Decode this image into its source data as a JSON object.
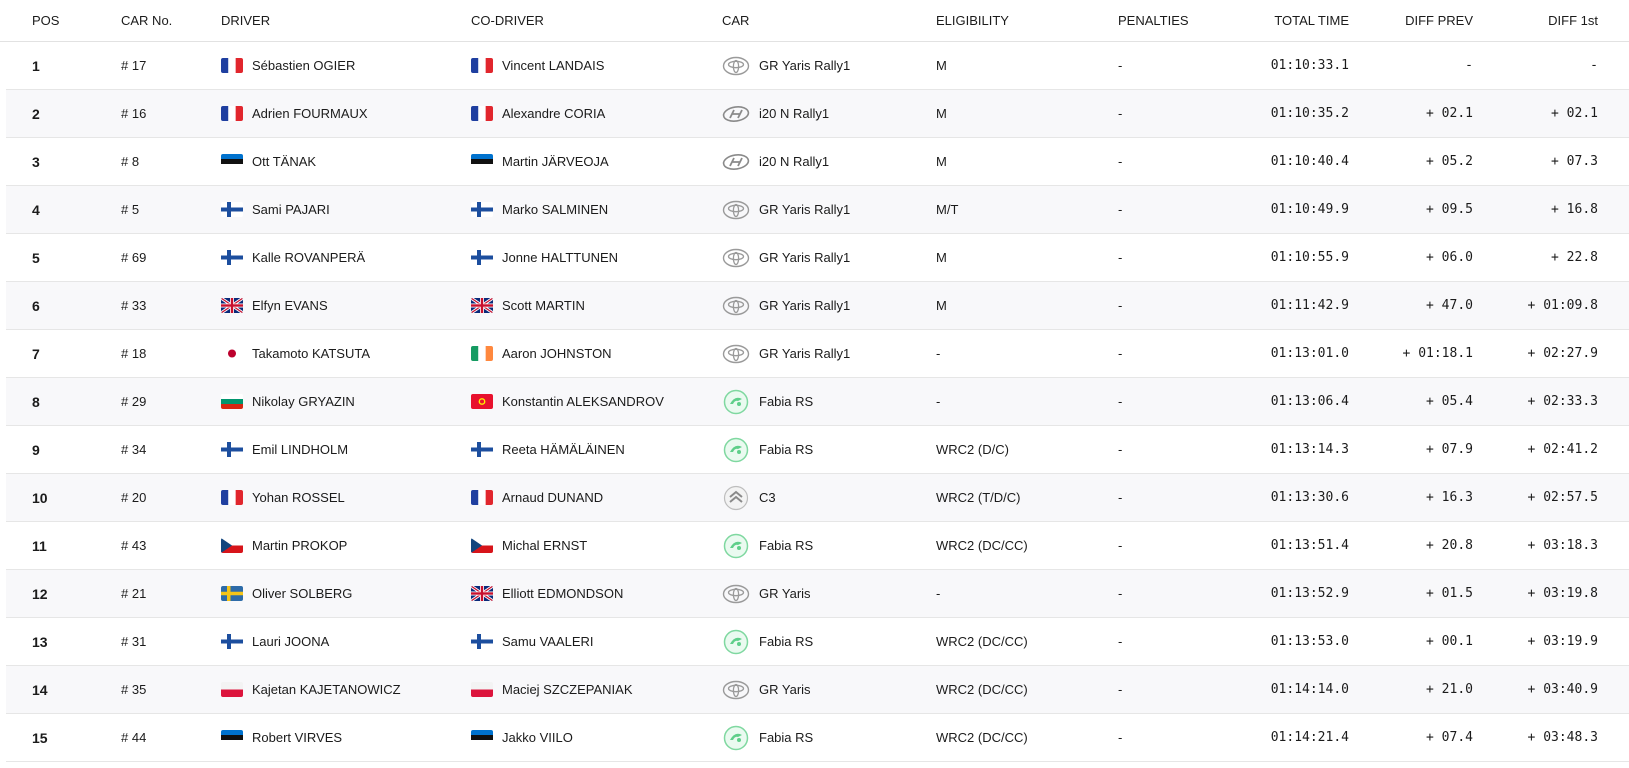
{
  "headers": {
    "pos": "POS",
    "car_no": "CAR No.",
    "driver": "DRIVER",
    "co_driver": "CO-DRIVER",
    "car": "CAR",
    "eligibility": "ELIGIBILITY",
    "penalties": "PENALTIES",
    "total_time": "TOTAL TIME",
    "diff_prev": "DIFF PREV",
    "diff_1st": "DIFF 1st"
  },
  "rows": [
    {
      "pos": "1",
      "car_no": "# 17",
      "driver": "Sébastien OGIER",
      "driver_flag": "fr",
      "co_driver": "Vincent LANDAIS",
      "co_driver_flag": "fr",
      "car": "GR Yaris Rally1",
      "car_logo": "toyota-logo",
      "eligibility": "M",
      "penalties": "-",
      "total_time": "01:10:33.1",
      "diff_prev": "-",
      "diff_1st": "-"
    },
    {
      "pos": "2",
      "car_no": "# 16",
      "driver": "Adrien FOURMAUX",
      "driver_flag": "fr",
      "co_driver": "Alexandre CORIA",
      "co_driver_flag": "fr",
      "car": "i20 N Rally1",
      "car_logo": "hyundai-logo",
      "eligibility": "M",
      "penalties": "-",
      "total_time": "01:10:35.2",
      "diff_prev": "+ 02.1",
      "diff_1st": "+ 02.1"
    },
    {
      "pos": "3",
      "car_no": "# 8",
      "driver": "Ott TÄNAK",
      "driver_flag": "ee",
      "co_driver": "Martin JÄRVEOJA",
      "co_driver_flag": "ee",
      "car": "i20 N Rally1",
      "car_logo": "hyundai-logo",
      "eligibility": "M",
      "penalties": "-",
      "total_time": "01:10:40.4",
      "diff_prev": "+ 05.2",
      "diff_1st": "+ 07.3"
    },
    {
      "pos": "4",
      "car_no": "# 5",
      "driver": "Sami PAJARI",
      "driver_flag": "fi",
      "co_driver": "Marko SALMINEN",
      "co_driver_flag": "fi",
      "car": "GR Yaris Rally1",
      "car_logo": "toyota-logo",
      "eligibility": "M/T",
      "penalties": "-",
      "total_time": "01:10:49.9",
      "diff_prev": "+ 09.5",
      "diff_1st": "+ 16.8"
    },
    {
      "pos": "5",
      "car_no": "# 69",
      "driver": "Kalle ROVANPERÄ",
      "driver_flag": "fi",
      "co_driver": "Jonne HALTTUNEN",
      "co_driver_flag": "fi",
      "car": "GR Yaris Rally1",
      "car_logo": "toyota-logo",
      "eligibility": "M",
      "penalties": "-",
      "total_time": "01:10:55.9",
      "diff_prev": "+ 06.0",
      "diff_1st": "+ 22.8"
    },
    {
      "pos": "6",
      "car_no": "# 33",
      "driver": "Elfyn EVANS",
      "driver_flag": "gb",
      "co_driver": "Scott MARTIN",
      "co_driver_flag": "gb",
      "car": "GR Yaris Rally1",
      "car_logo": "toyota-logo",
      "eligibility": "M",
      "penalties": "-",
      "total_time": "01:11:42.9",
      "diff_prev": "+ 47.0",
      "diff_1st": "+ 01:09.8"
    },
    {
      "pos": "7",
      "car_no": "# 18",
      "driver": "Takamoto KATSUTA",
      "driver_flag": "jp",
      "co_driver": "Aaron JOHNSTON",
      "co_driver_flag": "ie",
      "car": "GR Yaris Rally1",
      "car_logo": "toyota-logo",
      "eligibility": "-",
      "penalties": "-",
      "total_time": "01:13:01.0",
      "diff_prev": "+ 01:18.1",
      "diff_1st": "+ 02:27.9"
    },
    {
      "pos": "8",
      "car_no": "# 29",
      "driver": "Nikolay GRYAZIN",
      "driver_flag": "bg",
      "co_driver": "Konstantin ALEKSANDROV",
      "co_driver_flag": "kg",
      "car": "Fabia RS",
      "car_logo": "skoda-logo",
      "eligibility": "-",
      "penalties": "-",
      "total_time": "01:13:06.4",
      "diff_prev": "+ 05.4",
      "diff_1st": "+ 02:33.3"
    },
    {
      "pos": "9",
      "car_no": "# 34",
      "driver": "Emil LINDHOLM",
      "driver_flag": "fi",
      "co_driver": "Reeta HÄMÄLÄINEN",
      "co_driver_flag": "fi",
      "car": "Fabia RS",
      "car_logo": "skoda-logo",
      "eligibility": "WRC2 (D/C)",
      "penalties": "-",
      "total_time": "01:13:14.3",
      "diff_prev": "+ 07.9",
      "diff_1st": "+ 02:41.2"
    },
    {
      "pos": "10",
      "car_no": "# 20",
      "driver": "Yohan ROSSEL",
      "driver_flag": "fr",
      "co_driver": "Arnaud DUNAND",
      "co_driver_flag": "fr",
      "car": "C3",
      "car_logo": "citroen-logo",
      "eligibility": "WRC2 (T/D/C)",
      "penalties": "-",
      "total_time": "01:13:30.6",
      "diff_prev": "+ 16.3",
      "diff_1st": "+ 02:57.5"
    },
    {
      "pos": "11",
      "car_no": "# 43",
      "driver": "Martin PROKOP",
      "driver_flag": "cz",
      "co_driver": "Michal ERNST",
      "co_driver_flag": "cz",
      "car": "Fabia RS",
      "car_logo": "skoda-logo",
      "eligibility": "WRC2 (DC/CC)",
      "penalties": "-",
      "total_time": "01:13:51.4",
      "diff_prev": "+ 20.8",
      "diff_1st": "+ 03:18.3"
    },
    {
      "pos": "12",
      "car_no": "# 21",
      "driver": "Oliver SOLBERG",
      "driver_flag": "se",
      "co_driver": "Elliott EDMONDSON",
      "co_driver_flag": "gb",
      "car": "GR Yaris",
      "car_logo": "toyota-logo",
      "eligibility": "-",
      "penalties": "-",
      "total_time": "01:13:52.9",
      "diff_prev": "+ 01.5",
      "diff_1st": "+ 03:19.8"
    },
    {
      "pos": "13",
      "car_no": "# 31",
      "driver": "Lauri JOONA",
      "driver_flag": "fi",
      "co_driver": "Samu VAALERI",
      "co_driver_flag": "fi",
      "car": "Fabia RS",
      "car_logo": "skoda-logo",
      "eligibility": "WRC2 (DC/CC)",
      "penalties": "-",
      "total_time": "01:13:53.0",
      "diff_prev": "+ 00.1",
      "diff_1st": "+ 03:19.9"
    },
    {
      "pos": "14",
      "car_no": "# 35",
      "driver": "Kajetan KAJETANOWICZ",
      "driver_flag": "pl",
      "co_driver": "Maciej SZCZEPANIAK",
      "co_driver_flag": "pl",
      "car": "GR Yaris",
      "car_logo": "toyota-logo",
      "eligibility": "WRC2 (DC/CC)",
      "penalties": "-",
      "total_time": "01:14:14.0",
      "diff_prev": "+ 21.0",
      "diff_1st": "+ 03:40.9"
    },
    {
      "pos": "15",
      "car_no": "# 44",
      "driver": "Robert VIRVES",
      "driver_flag": "ee",
      "co_driver": "Jakko VIILO",
      "co_driver_flag": "ee",
      "car": "Fabia RS",
      "car_logo": "skoda-logo",
      "eligibility": "WRC2 (DC/CC)",
      "penalties": "-",
      "total_time": "01:14:21.4",
      "diff_prev": "+ 07.4",
      "diff_1st": "+ 03:48.3"
    }
  ],
  "colors": {
    "row_alt": "#f8f8fa",
    "border": "#e6e6e6",
    "skoda_green": "#4ba82e"
  }
}
